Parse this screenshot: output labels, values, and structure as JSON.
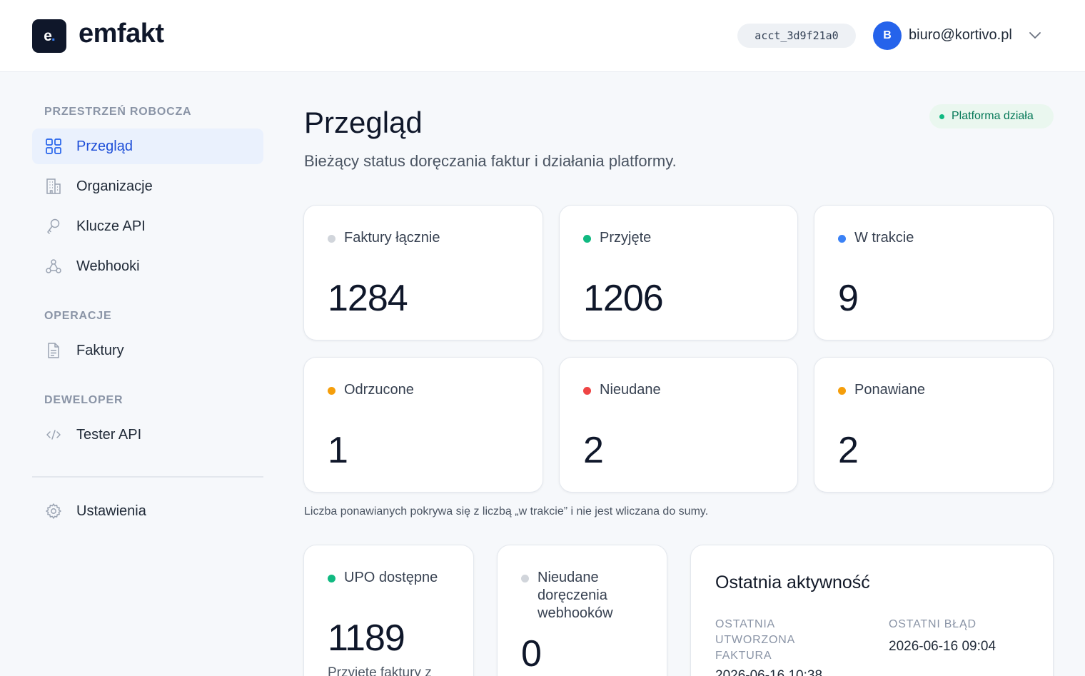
{
  "header": {
    "logo_mark": "e",
    "logo_dot": ".",
    "brand": "emfakt",
    "account_id": "acct_3d9f21a0",
    "avatar_initial": "B",
    "user_email": "biuro@kortivo.pl"
  },
  "sidebar": {
    "section_workspace": "PRZESTRZEŃ ROBOCZA",
    "section_operations": "OPERACJE",
    "section_developer": "DEWELOPER",
    "items": [
      {
        "label": "Przegląd",
        "icon": "grid-icon",
        "active": true
      },
      {
        "label": "Organizacje",
        "icon": "building-icon",
        "active": false
      },
      {
        "label": "Klucze API",
        "icon": "key-icon",
        "active": false
      },
      {
        "label": "Webhooki",
        "icon": "webhook-icon",
        "active": false
      },
      {
        "label": "Faktury",
        "icon": "document-icon",
        "active": false
      },
      {
        "label": "Tester API",
        "icon": "code-icon",
        "active": false
      },
      {
        "label": "Ustawienia",
        "icon": "gear-icon",
        "active": false
      }
    ]
  },
  "main": {
    "title": "Przegląd",
    "subtitle": "Bieżący status doręczania faktur i działania platformy.",
    "status": "Platforma działa",
    "stats": [
      {
        "label": "Faktury łącznie",
        "value": "1284",
        "color": "#d1d5db"
      },
      {
        "label": "Przyjęte",
        "value": "1206",
        "color": "#10b981"
      },
      {
        "label": "W trakcie",
        "value": "9",
        "color": "#3b82f6"
      },
      {
        "label": "Odrzucone",
        "value": "1",
        "color": "#f59e0b"
      },
      {
        "label": "Nieudane",
        "value": "2",
        "color": "#ef4444"
      },
      {
        "label": "Ponawiane",
        "value": "2",
        "color": "#f59e0b"
      }
    ],
    "note": "Liczba ponawianych pokrywa się z liczbą „w trakcie” i nie jest wliczana do sumy.",
    "upo": {
      "label": "UPO dostępne",
      "value": "1189",
      "sub": "Przyjęte faktury z",
      "color": "#10b981"
    },
    "webhooks": {
      "label": "Nieudane doręczenia webhooków",
      "value": "0",
      "color": "#d1d5db"
    },
    "activity": {
      "title": "Ostatnia aktywność",
      "last_created_label": "OSTATNIA UTWORZONA FAKTURA",
      "last_created_value": "2026-06-16 10:38",
      "last_error_label": "OSTATNI BŁĄD",
      "last_error_value": "2026-06-16 09:04"
    }
  }
}
